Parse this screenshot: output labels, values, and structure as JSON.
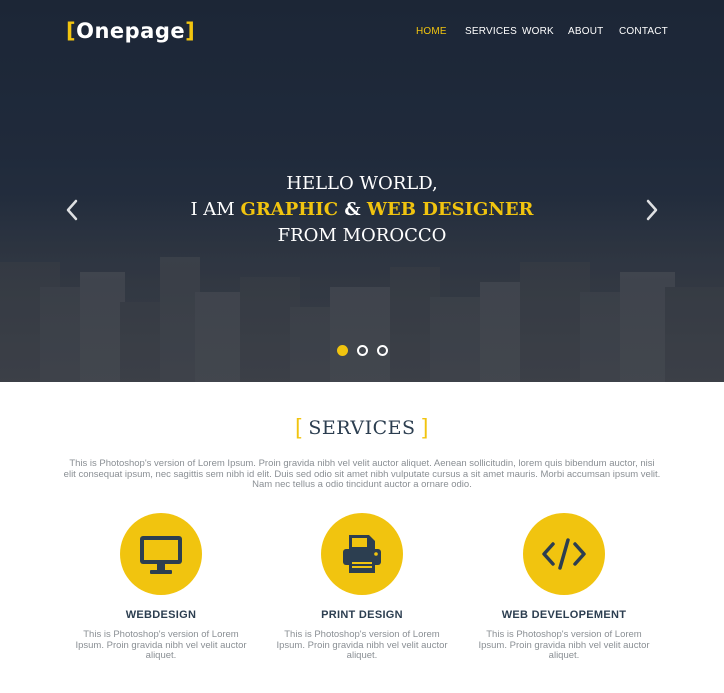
{
  "brand": {
    "logo_text": "Onepage",
    "accent": "#f1c40f",
    "dark": "#2c3e50"
  },
  "nav": {
    "items": [
      {
        "label": "HOME",
        "active": true
      },
      {
        "label": "SERVICES",
        "active": false
      },
      {
        "label": "WORK",
        "active": false
      },
      {
        "label": "ABOUT",
        "active": false
      },
      {
        "label": "CONTACT",
        "active": false
      }
    ]
  },
  "hero": {
    "line1": "HELLO WORLD,",
    "line2_prefix": "I AM ",
    "line2_hl1": "GRAPHIC",
    "line2_amp": " & ",
    "line2_hl2": "WEB DESIGNER",
    "line3": "FROM MOROCCO",
    "prev_icon": "chevron-left-icon",
    "next_icon": "chevron-right-icon",
    "slides": {
      "count": 3,
      "active_index": 0
    }
  },
  "services": {
    "title": "SERVICES",
    "description": "This is Photoshop's version  of Lorem Ipsum. Proin gravida nibh vel velit auctor aliquet. Aenean sollicitudin, lorem quis bibendum auctor, nisi elit consequat ipsum, nec sagittis sem nibh id elit. Duis sed odio sit amet nibh vulputate cursus a sit amet mauris. Morbi accumsan ipsum velit. Nam nec tellus a odio tincidunt auctor a ornare odio.",
    "items": [
      {
        "icon": "monitor-icon",
        "name": "WEBDESIGN",
        "text": "This is Photoshop's version  of Lorem Ipsum. Proin gravida nibh vel velit auctor aliquet."
      },
      {
        "icon": "printer-icon",
        "name": "PRINT DESIGN",
        "text": "This is Photoshop's version  of Lorem Ipsum. Proin gravida nibh vel velit auctor aliquet."
      },
      {
        "icon": "code-icon",
        "name": "WEB DEVELOPEMENT",
        "text": "This is Photoshop's version  of Lorem Ipsum. Proin gravida nibh vel velit auctor aliquet."
      }
    ]
  }
}
